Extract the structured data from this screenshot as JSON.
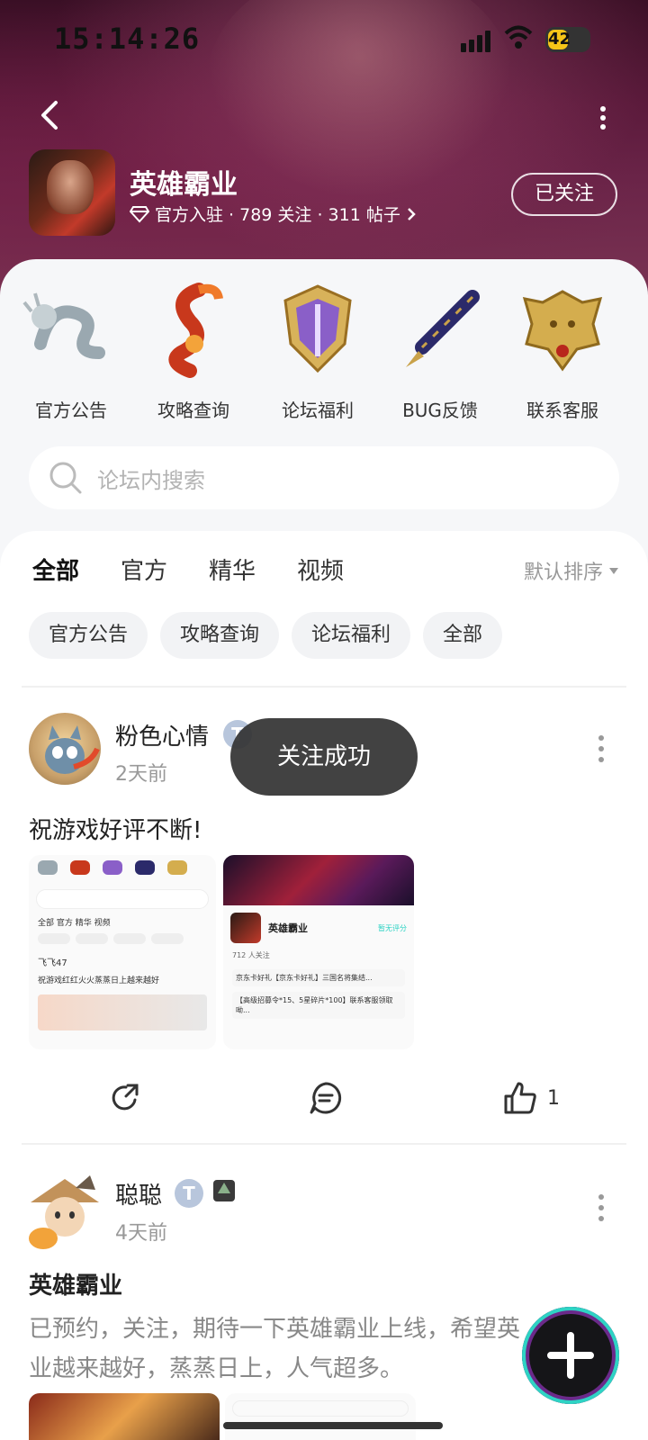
{
  "status_bar": {
    "time": "15:14:26",
    "battery": "42"
  },
  "header": {
    "title": "英雄霸业",
    "meta": "官方入驻 · 789 关注 · 311 帖子",
    "follow_label": "已关注"
  },
  "quick_links": [
    {
      "label": "官方公告",
      "icon": "silver-dragon-icon"
    },
    {
      "label": "攻略查询",
      "icon": "fire-dragon-icon"
    },
    {
      "label": "论坛福利",
      "icon": "gold-shield-icon"
    },
    {
      "label": "BUG反馈",
      "icon": "pen-icon"
    },
    {
      "label": "联系客服",
      "icon": "gold-emblem-icon"
    }
  ],
  "search": {
    "placeholder": "论坛内搜索"
  },
  "tabs": [
    "全部",
    "官方",
    "精华",
    "视频"
  ],
  "sort_label": "默认排序",
  "chips": [
    "官方公告",
    "攻略查询",
    "论坛福利",
    "全部"
  ],
  "toast": "关注成功",
  "posts": [
    {
      "author": "粉色心情",
      "time": "2天前",
      "text": "祝游戏好评不断!",
      "thumb1": {
        "tabs": "全部  官方  精华  视频",
        "user": "飞飞47",
        "text": "祝游戏红红火火蒸蒸日上越来越好"
      },
      "thumb2": {
        "title": "英雄霸业",
        "tag": "暂无评分",
        "line1": "712 人关注",
        "line2": "京东卡好礼【京东卡好礼】三国名将集结...",
        "line3": "【高级招募令*15、5星碎片*100】联系客服领取呦..."
      },
      "likes": "1"
    },
    {
      "author": "聪聪",
      "time": "4天前",
      "title": "英雄霸业",
      "text_line1": "已预约，关注，期待一下英雄霸业上线，希望英",
      "text_line2": "业越来越好，蒸蒸日上，人气超多。"
    }
  ],
  "colors": {
    "accent": "#2ed3c4",
    "banner": "#5b1a3b"
  }
}
